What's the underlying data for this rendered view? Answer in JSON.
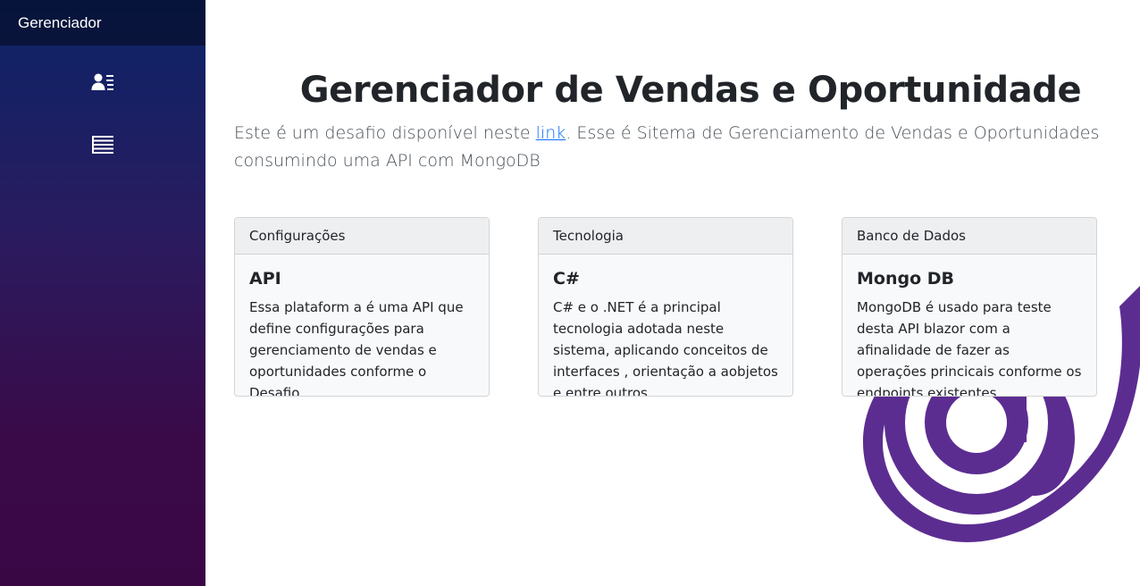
{
  "sidebar": {
    "brand": "Gerenciador",
    "nav": [
      {
        "icon": "person-lines-icon"
      },
      {
        "icon": "list-text-icon"
      }
    ]
  },
  "header": {
    "title": "Gerenciador de Vendas e Oportunidade"
  },
  "intro": {
    "text_before": "Este é um desafio disponível neste ",
    "link_label": "link",
    "text_after": ". Esse é Sitema de Gerenciamento de Vendas e Oportunidades consumindo uma API com MongoDB"
  },
  "cards": [
    {
      "header": "Configurações",
      "title": "API",
      "text": "Essa plataform a é uma API que define configurações para gerenciamento de vendas e oportunidades conforme o Desafio."
    },
    {
      "header": "Tecnologia",
      "title": "C#",
      "text": "C# e o .NET é a principal tecnologia adotada neste sistema, aplicando conceitos de interfaces , orientação a aobjetos e entre outros."
    },
    {
      "header": "Banco de Dados",
      "title": "Mongo DB",
      "text": "MongoDB é usado para teste desta API blazor com a afinalidade de fazer as operações princicais conforme os endpoints existentes."
    }
  ],
  "colors": {
    "sidebar_top": "#0b2467",
    "sidebar_bottom": "#3a0745",
    "logo_purple": "#5c2d91",
    "link": "#0d6efd"
  }
}
